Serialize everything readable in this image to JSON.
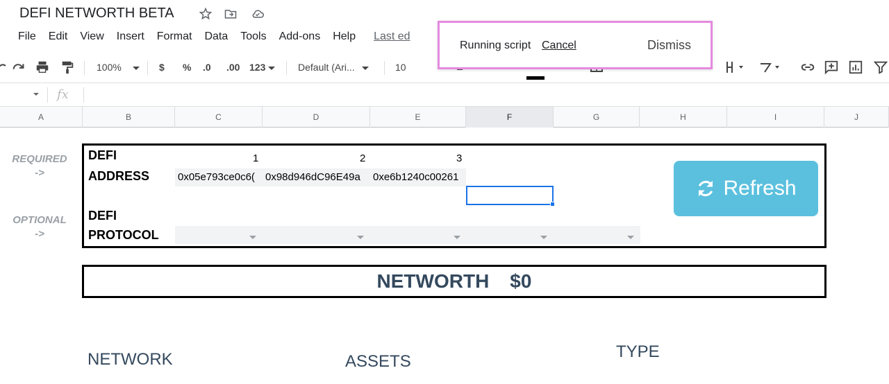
{
  "document": {
    "title": "DEFI NETWORTH BETA"
  },
  "menu": {
    "items": [
      "File",
      "Edit",
      "View",
      "Insert",
      "Format",
      "Data",
      "Tools",
      "Add-ons",
      "Help"
    ],
    "last_edit": "Last ed"
  },
  "toolbar": {
    "zoom": "100%",
    "currency": "$",
    "percent": "%",
    "decrease_decimal": ".0",
    "increase_decimal": ".00",
    "more_formats": "123",
    "font": "Default (Ari...",
    "font_size": "10"
  },
  "formula_bar": {
    "fx": "fx"
  },
  "columns": [
    "A",
    "B",
    "C",
    "D",
    "E",
    "F",
    "G",
    "H",
    "I",
    "J"
  ],
  "sheet": {
    "required_label": "REQUIRED",
    "required_arrow": "->",
    "optional_label": "OPTIONAL",
    "optional_arrow": "->",
    "defi_label_1": "DEFI",
    "address_label": "ADDRESS",
    "defi_label_2": "DEFI",
    "protocol_label": "PROTOCOL",
    "indexes": [
      "1",
      "2",
      "3"
    ],
    "addresses": [
      "0x05e793ce0c6(",
      "0x98d946dC96E49a",
      "0xe6b1240c00261"
    ],
    "refresh_label": "Refresh",
    "networth_label": "NETWORTH",
    "networth_value": "$0",
    "network_head": "NETWORK",
    "assets_head": "ASSETS",
    "type_head": "TYPE"
  },
  "snackbar": {
    "message": "Running script",
    "cancel": "Cancel",
    "dismiss": "Dismiss"
  },
  "colors": {
    "refresh_bg": "#5bc0de",
    "selection": "#1a73e8",
    "snackbar_highlight": "#e58ae0",
    "heading_text": "#34495e"
  }
}
